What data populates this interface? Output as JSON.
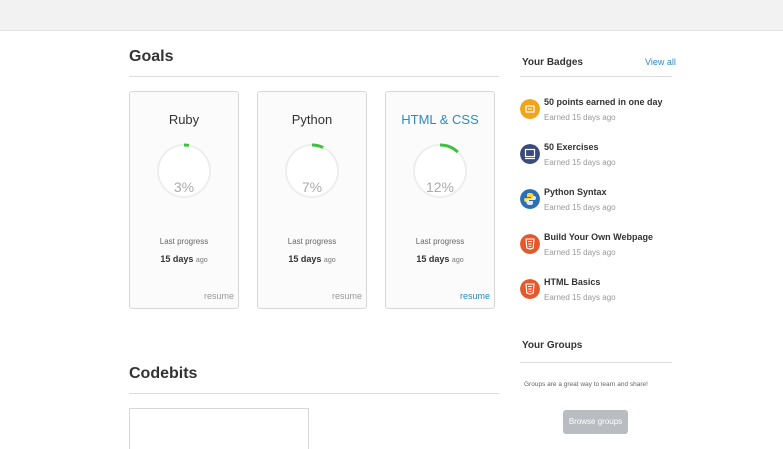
{
  "goals": {
    "title": "Goals",
    "cards": [
      {
        "name": "Ruby",
        "percent": 3,
        "percent_label": "3%",
        "last_progress_label": "Last progress",
        "days": "15 days",
        "ago": "ago",
        "resume": "resume",
        "name_color": "#333333",
        "resume_color": "#999999"
      },
      {
        "name": "Python",
        "percent": 7,
        "percent_label": "7%",
        "last_progress_label": "Last progress",
        "days": "15 days",
        "ago": "ago",
        "resume": "resume",
        "name_color": "#333333",
        "resume_color": "#999999"
      },
      {
        "name": "HTML & CSS",
        "percent": 12,
        "percent_label": "12%",
        "last_progress_label": "Last progress",
        "days": "15 days",
        "ago": "ago",
        "resume": "resume",
        "name_color": "#2d8ac7",
        "resume_color": "#2d8ac7"
      }
    ],
    "progress_color": "#3cc23c"
  },
  "codebits": {
    "title": "Codebits"
  },
  "badges": {
    "title": "Your Badges",
    "view_all": "View all",
    "items": [
      {
        "title": "50 points earned in one day",
        "subtitle": "Earned 15 days ago",
        "icon": "points-badge-icon",
        "color": "#f0a31b"
      },
      {
        "title": "50 Exercises",
        "subtitle": "Earned 15 days ago",
        "icon": "exercises-badge-icon",
        "color": "#3a4a7a"
      },
      {
        "title": "Python Syntax",
        "subtitle": "Earned 15 days ago",
        "icon": "python-badge-icon",
        "color": "#2a6eb5"
      },
      {
        "title": "Build Your Own Webpage",
        "subtitle": "Earned 15 days ago",
        "icon": "html5-badge-icon",
        "color": "#e25a2b"
      },
      {
        "title": "HTML Basics",
        "subtitle": "Earned 15 days ago",
        "icon": "html5-badge-icon",
        "color": "#e25a2b"
      }
    ]
  },
  "groups": {
    "title": "Your Groups",
    "text": "Groups are a great way to learn and share!",
    "button": "Browse groups"
  }
}
